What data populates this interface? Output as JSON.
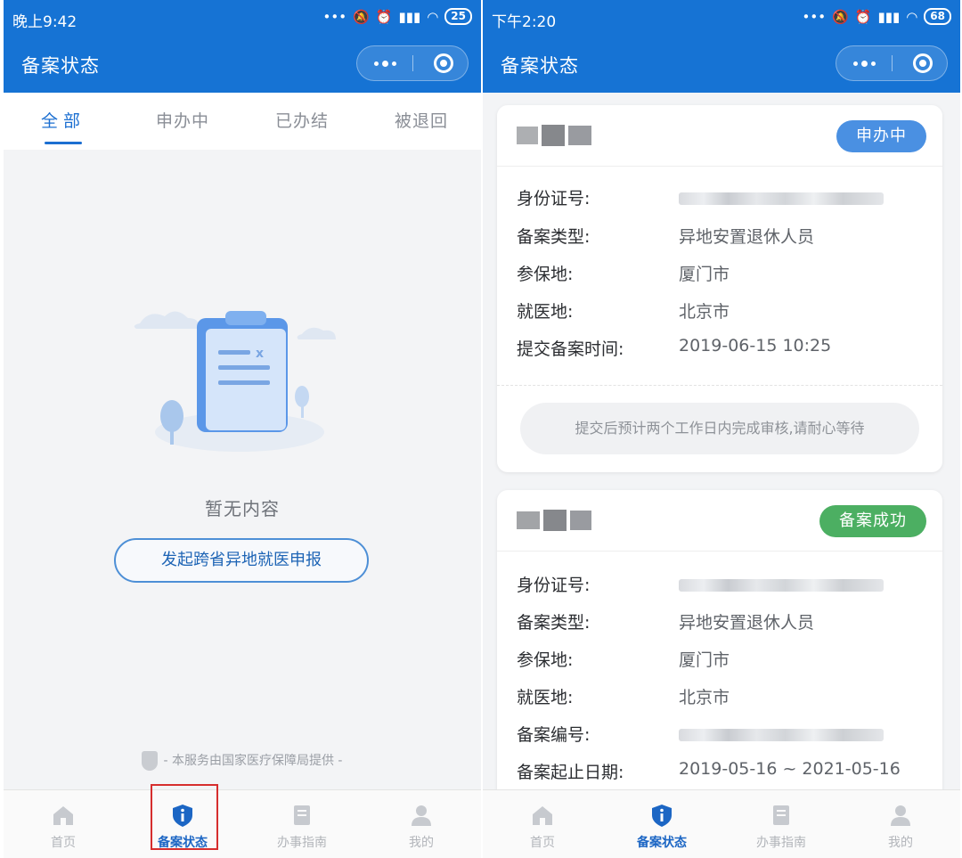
{
  "colors": {
    "primary": "#1673d4",
    "tab_active": "#1c6fd1",
    "badge_processing": "#4a90e2",
    "badge_success": "#4caf62",
    "highlight_box": "#d62e2e"
  },
  "left_screen": {
    "status_bar": {
      "time": "晚上9:42",
      "battery": "25"
    },
    "nav_title": "备案状态",
    "tabs": [
      {
        "label": "全部",
        "active": true
      },
      {
        "label": "申办中",
        "active": false
      },
      {
        "label": "已办结",
        "active": false
      },
      {
        "label": "被退回",
        "active": false
      }
    ],
    "empty_text": "暂无内容",
    "start_button": "发起跨省异地就医申报",
    "footer_note": "- 本服务由国家医疗保障局提供 -",
    "tabbar": [
      {
        "label": "首页",
        "icon": "home-icon",
        "active": false
      },
      {
        "label": "备案状态",
        "icon": "shield-info-icon",
        "active": true
      },
      {
        "label": "办事指南",
        "icon": "guide-book-icon",
        "active": false
      },
      {
        "label": "我的",
        "icon": "user-icon",
        "active": false
      }
    ]
  },
  "right_screen": {
    "status_bar": {
      "time": "下午2:20",
      "battery": "68"
    },
    "nav_title": "备案状态",
    "records": [
      {
        "status": "申办中",
        "fields": [
          {
            "label": "身份证号:",
            "value": ""
          },
          {
            "label": "备案类型:",
            "value": "异地安置退休人员"
          },
          {
            "label": "参保地:",
            "value": "厦门市"
          },
          {
            "label": "就医地:",
            "value": "北京市"
          },
          {
            "label": "提交备案时间:",
            "value": "2019-06-15 10:25"
          }
        ],
        "notice": "提交后预计两个工作日内完成审核,请耐心等待"
      },
      {
        "status": "备案成功",
        "fields": [
          {
            "label": "身份证号:",
            "value": ""
          },
          {
            "label": "备案类型:",
            "value": "异地安置退休人员"
          },
          {
            "label": "参保地:",
            "value": "厦门市"
          },
          {
            "label": "就医地:",
            "value": "北京市"
          },
          {
            "label": "备案编号:",
            "value": ""
          },
          {
            "label": "备案起止日期:",
            "value": "2019-05-16 ~ 2021-05-16"
          }
        ]
      }
    ],
    "tabbar": [
      {
        "label": "首页",
        "icon": "home-icon",
        "active": false
      },
      {
        "label": "备案状态",
        "icon": "shield-info-icon",
        "active": true
      },
      {
        "label": "办事指南",
        "icon": "guide-book-icon",
        "active": false
      },
      {
        "label": "我的",
        "icon": "user-icon",
        "active": false
      }
    ]
  }
}
